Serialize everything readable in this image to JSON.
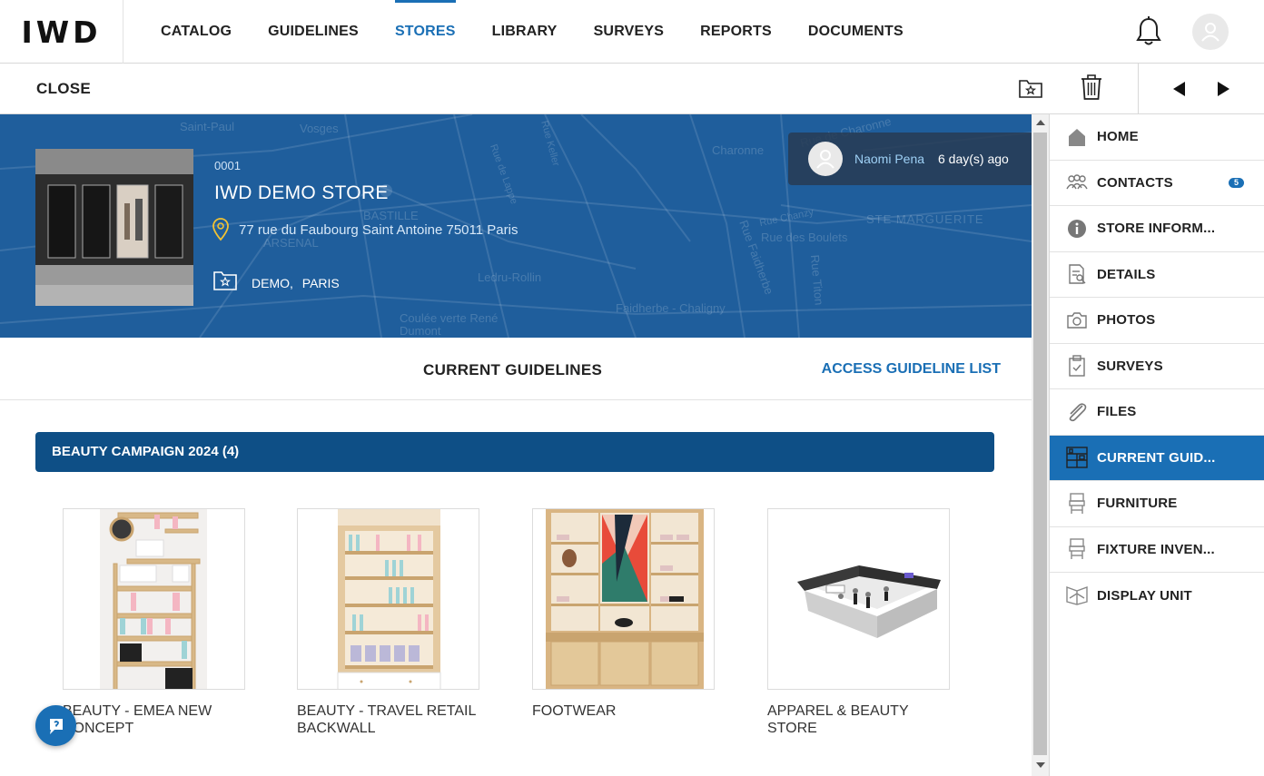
{
  "app": {
    "logo": "IWD"
  },
  "nav": {
    "items": [
      {
        "label": "CATALOG",
        "active": false
      },
      {
        "label": "GUIDELINES",
        "active": false
      },
      {
        "label": "STORES",
        "active": true
      },
      {
        "label": "LIBRARY",
        "active": false
      },
      {
        "label": "SURVEYS",
        "active": false
      },
      {
        "label": "REPORTS",
        "active": false
      },
      {
        "label": "DOCUMENTS",
        "active": false
      }
    ],
    "icons": [
      "bell-icon",
      "user-avatar-icon"
    ]
  },
  "toolbar": {
    "close_label": "CLOSE",
    "icons": [
      "favorite-folder-icon",
      "trash-icon",
      "previous-arrow-icon",
      "next-arrow-icon"
    ]
  },
  "store": {
    "code": "0001",
    "name": "IWD DEMO STORE",
    "address": "77 rue du Faubourg Saint Antoine 75011 Paris",
    "tags": [
      "DEMO,",
      "PARIS"
    ],
    "last_update": {
      "user": "Naomi Pena",
      "ago": "6 day(s) ago"
    }
  },
  "map_labels": [
    "Saint-Paul",
    "Vosges",
    "Charonne",
    "Rue de Charonne",
    "BASTILLE",
    "ARSENAL",
    "STE MARGUERITE",
    "Rue des Boulets",
    "Ledru-Rollin",
    "Faidherbe - Chaligny",
    "Coulée verte René Dumont",
    "Rue Faidherbe",
    "Rue Titon",
    "Rue Chanzy",
    "Rue de Lappe",
    "Rue Keller"
  ],
  "guidelines": {
    "title": "CURRENT GUIDELINES",
    "link": "ACCESS GUIDELINE LIST",
    "campaign": "BEAUTY CAMPAIGN 2024 (4)",
    "cards": [
      {
        "label": "BEAUTY - EMEA NEW CONCEPT"
      },
      {
        "label": "BEAUTY - TRAVEL RETAIL BACKWALL"
      },
      {
        "label": "FOOTWEAR"
      },
      {
        "label": "APPAREL & BEAUTY STORE"
      }
    ]
  },
  "sidemenu": {
    "items": [
      {
        "label": "HOME",
        "icon": "home-icon",
        "active": false
      },
      {
        "label": "CONTACTS",
        "icon": "contacts-icon",
        "active": false,
        "badge": "5"
      },
      {
        "label": "STORE INFORM...",
        "icon": "info-icon",
        "active": false
      },
      {
        "label": "DETAILS",
        "icon": "details-icon",
        "active": false
      },
      {
        "label": "PHOTOS",
        "icon": "camera-icon",
        "active": false
      },
      {
        "label": "SURVEYS",
        "icon": "clipboard-icon",
        "active": false
      },
      {
        "label": "FILES",
        "icon": "paperclip-icon",
        "active": false
      },
      {
        "label": "CURRENT GUID...",
        "icon": "shelf-icon",
        "active": true
      },
      {
        "label": "FURNITURE",
        "icon": "furniture-icon",
        "active": false
      },
      {
        "label": "FIXTURE INVEN...",
        "icon": "fixture-icon",
        "active": false
      },
      {
        "label": "DISPLAY UNIT",
        "icon": "display-unit-icon",
        "active": false
      }
    ]
  },
  "colors": {
    "accent": "#1a6fb5",
    "campaign_bar": "#0e4f86",
    "hero_bg": "#1f5e9c"
  }
}
